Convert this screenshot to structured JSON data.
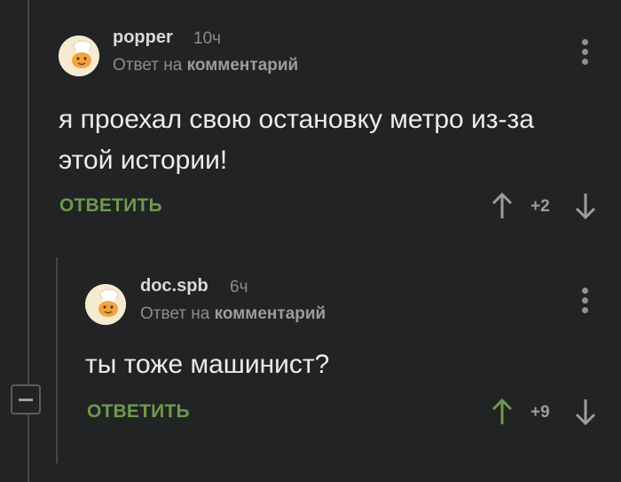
{
  "comments": [
    {
      "username": "popper",
      "time": "10ч",
      "reply_prefix": "Ответ на",
      "reply_target": "комментарий",
      "text": "я проехал свою остановку метро из-за этой истории!",
      "reply_label": "ОТВЕТИТЬ",
      "score": "+2",
      "upvoted": false
    },
    {
      "username": "doc.spb",
      "time": "6ч",
      "reply_prefix": "Ответ на",
      "reply_target": "комментарий",
      "text": "ты тоже машинист?",
      "reply_label": "ОТВЕТИТЬ",
      "score": "+9",
      "upvoted": true
    }
  ],
  "colors": {
    "background": "#212324",
    "accent_green": "#6d9a4c",
    "muted": "#8a8c8e",
    "upvote_active": "#6d9a4c",
    "vote_inactive": "#9a9c9e"
  },
  "icons": {
    "avatar": "chef-avatar-icon",
    "menu": "more-vertical-icon",
    "upvote": "arrow-up-icon",
    "downvote": "arrow-down-icon",
    "collapse": "minus-square-icon"
  }
}
